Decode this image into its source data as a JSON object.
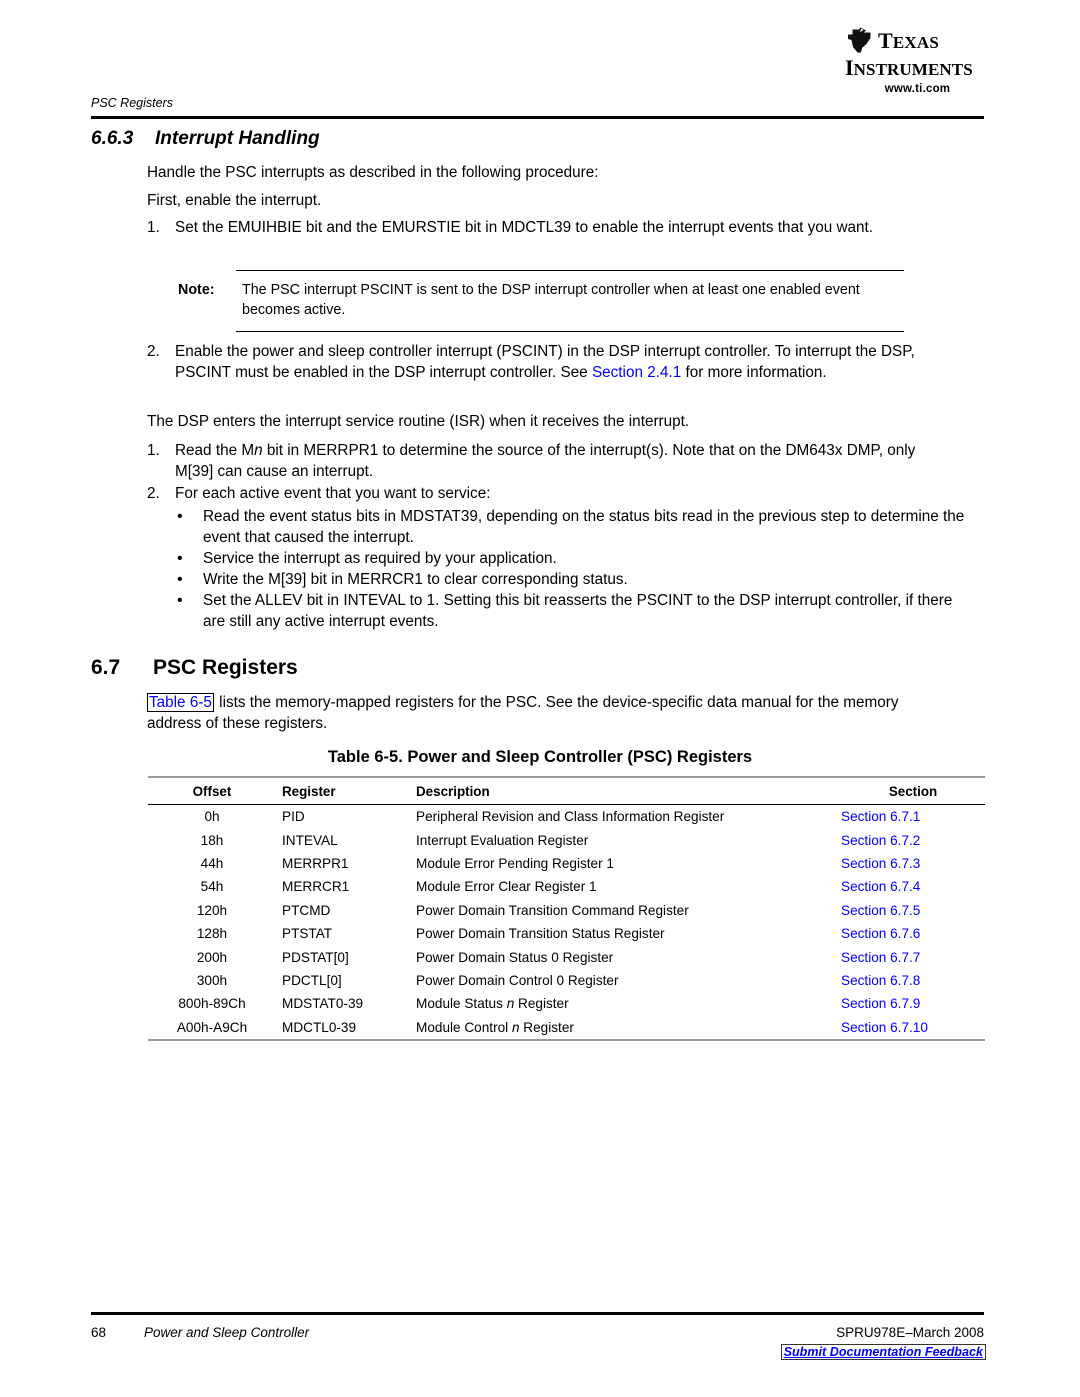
{
  "logo": {
    "brand_line1": "TEXAS",
    "brand_line2": "INSTRUMENTS",
    "url": "www.ti.com",
    "mark_name": "texas-outline-mark"
  },
  "header": {
    "running_head": "PSC Registers"
  },
  "section_663": {
    "number": "6.6.3",
    "title": "Interrupt Handling",
    "intro1": "Handle the PSC interrupts as described in the following procedure:",
    "intro2": "First, enable the interrupt.",
    "step1_marker": "1.",
    "step1_text": "Set the EMUIHBIE bit and the EMURSTIE bit in MDCTL39 to enable the interrupt events that you want.",
    "note_label": "Note:",
    "note_text": "The PSC interrupt PSCINT is sent to the DSP interrupt controller when at least one enabled event becomes active.",
    "step2_marker": "2.",
    "step2_text_a": "Enable the power and sleep controller interrupt (PSCINT) in the DSP interrupt controller. To interrupt the DSP, PSCINT must be enabled in the DSP interrupt controller. See ",
    "step2_link": "Section 2.4.1",
    "step2_text_b": " for more information.",
    "isr_para": "The DSP enters the interrupt service routine (ISR) when it receives the interrupt.",
    "isr_step1_marker": "1.",
    "isr_step1_a": "Read the M",
    "isr_step1_ital": "n",
    "isr_step1_b": " bit in MERRPR1 to determine the source of the interrupt(s). Note that on the DM643x DMP, only M[39] can cause an interrupt.",
    "isr_step2_marker": "2.",
    "isr_step2_text": "For each active event that you want to service:",
    "bullet_glyph": "•",
    "bullets": [
      "Read the event status bits in MDSTAT39, depending on the status bits read in the previous step to determine the event that caused the interrupt.",
      "Service the interrupt as required by your application.",
      "Write the M[39] bit in MERRCR1 to clear corresponding status.",
      "Set the ALLEV bit in INTEVAL to 1. Setting this bit reasserts the PSCINT to the DSP interrupt controller, if there are still any active interrupt events."
    ]
  },
  "section_67": {
    "number": "6.7",
    "title": "PSC Registers",
    "intro_link": "Table 6-5",
    "intro_text": " lists the memory-mapped registers for the PSC. See the device-specific data manual for the memory address of these registers."
  },
  "table": {
    "caption": "Table 6-5. Power and Sleep Controller (PSC) Registers",
    "headers": [
      "Offset",
      "Register",
      "Description",
      "Section"
    ],
    "rows": [
      {
        "offset": "0h",
        "register": "PID",
        "desc_a": "Peripheral Revision and Class Information Register",
        "desc_ital": "",
        "desc_b": "",
        "section": "Section 6.7.1"
      },
      {
        "offset": "18h",
        "register": "INTEVAL",
        "desc_a": "Interrupt Evaluation Register",
        "desc_ital": "",
        "desc_b": "",
        "section": "Section 6.7.2"
      },
      {
        "offset": "44h",
        "register": "MERRPR1",
        "desc_a": "Module Error Pending Register 1",
        "desc_ital": "",
        "desc_b": "",
        "section": "Section 6.7.3"
      },
      {
        "offset": "54h",
        "register": "MERRCR1",
        "desc_a": "Module Error Clear Register 1",
        "desc_ital": "",
        "desc_b": "",
        "section": "Section 6.7.4"
      },
      {
        "offset": "120h",
        "register": "PTCMD",
        "desc_a": "Power Domain Transition Command Register",
        "desc_ital": "",
        "desc_b": "",
        "section": "Section 6.7.5"
      },
      {
        "offset": "128h",
        "register": "PTSTAT",
        "desc_a": "Power Domain Transition Status Register",
        "desc_ital": "",
        "desc_b": "",
        "section": "Section 6.7.6"
      },
      {
        "offset": "200h",
        "register": "PDSTAT[0]",
        "desc_a": "Power Domain Status 0 Register",
        "desc_ital": "",
        "desc_b": "",
        "section": "Section 6.7.7"
      },
      {
        "offset": "300h",
        "register": "PDCTL[0]",
        "desc_a": "Power Domain Control 0 Register",
        "desc_ital": "",
        "desc_b": "",
        "section": "Section 6.7.8"
      },
      {
        "offset": "800h-89Ch",
        "register": "MDSTAT0-39",
        "desc_a": "Module Status ",
        "desc_ital": "n",
        "desc_b": " Register",
        "section": "Section 6.7.9"
      },
      {
        "offset": "A00h-A9Ch",
        "register": "MDCTL0-39",
        "desc_a": "Module Control ",
        "desc_ital": "n",
        "desc_b": " Register",
        "section": "Section 6.7.10"
      }
    ]
  },
  "footer": {
    "page_number": "68",
    "doc_title": "Power and Sleep Controller",
    "doc_id": "SPRU978E–March 2008",
    "feedback": "Submit Documentation Feedback"
  },
  "colors": {
    "link": "#0000FF",
    "text": "#000000",
    "rule": "#000000",
    "table_edge": "#9A9A9A"
  }
}
